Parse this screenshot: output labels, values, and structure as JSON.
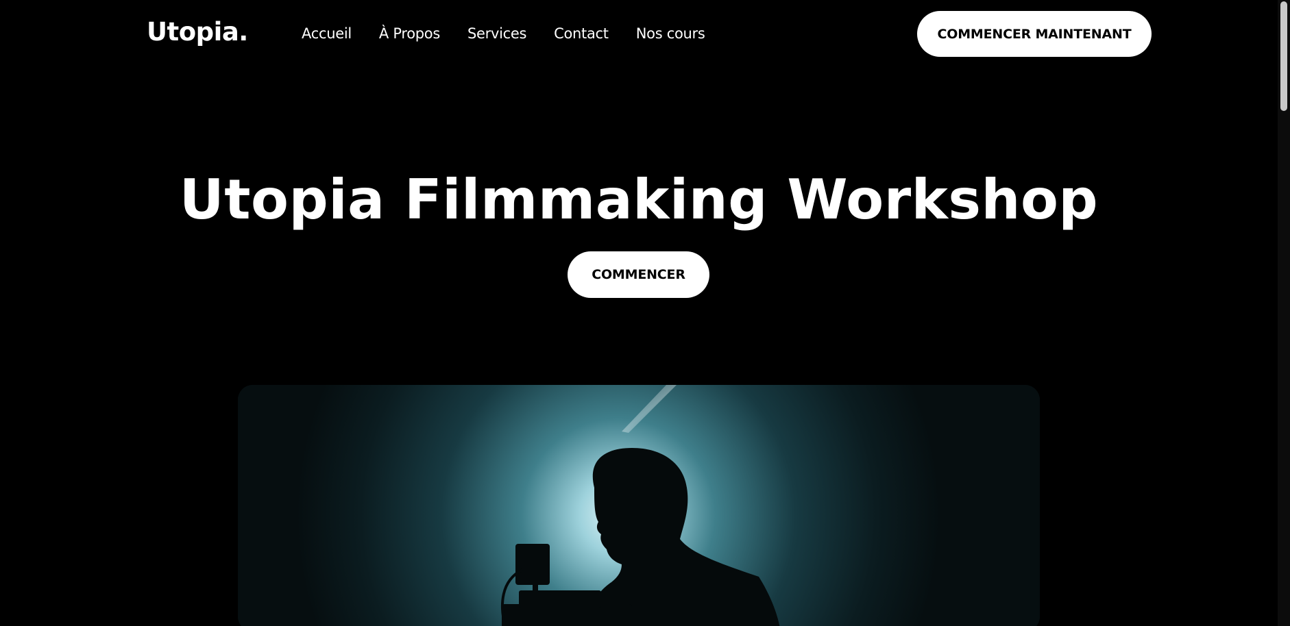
{
  "header": {
    "logo": "Utopia.",
    "nav": [
      {
        "label": "Accueil"
      },
      {
        "label": "À Propos"
      },
      {
        "label": "Services"
      },
      {
        "label": "Contact"
      },
      {
        "label": "Nos cours"
      }
    ],
    "cta_label": "COMMENCER MAINTENANT"
  },
  "hero": {
    "title": "Utopia Filmmaking Workshop",
    "cta_label": "COMMENCER"
  },
  "colors": {
    "background": "#000000",
    "text": "#ffffff",
    "button_bg": "#ffffff",
    "button_text": "#000000",
    "glow": "#9ed2dc"
  }
}
